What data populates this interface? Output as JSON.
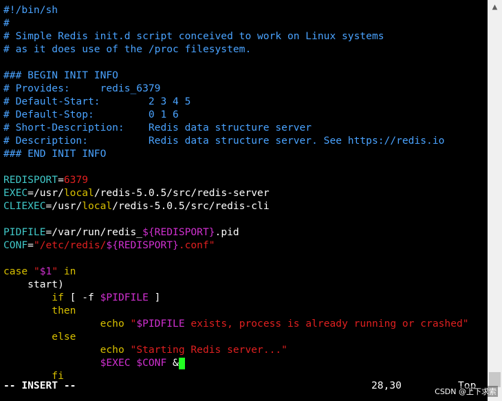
{
  "editor": {
    "lines": [
      [
        {
          "t": "#!/bin/sh",
          "c": "comment"
        }
      ],
      [
        {
          "t": "#",
          "c": "comment"
        }
      ],
      [
        {
          "t": "# Simple Redis init.d script conceived to work on Linux systems",
          "c": "comment"
        }
      ],
      [
        {
          "t": "# as it does use of the /proc filesystem.",
          "c": "comment"
        }
      ],
      [],
      [
        {
          "t": "### BEGIN INIT INFO",
          "c": "comment"
        }
      ],
      [
        {
          "t": "# Provides:     redis_6379",
          "c": "comment"
        }
      ],
      [
        {
          "t": "# Default-Start:        2 3 4 5",
          "c": "comment"
        }
      ],
      [
        {
          "t": "# Default-Stop:         0 1 6",
          "c": "comment"
        }
      ],
      [
        {
          "t": "# Short-Description:    Redis data structure server",
          "c": "comment"
        }
      ],
      [
        {
          "t": "# Description:          Redis data structure server. See https://redis.io",
          "c": "comment"
        }
      ],
      [
        {
          "t": "### END INIT INFO",
          "c": "comment"
        }
      ],
      [],
      [
        {
          "t": "REDISPORT",
          "c": "id"
        },
        {
          "t": "=",
          "c": "plain"
        },
        {
          "t": "6379",
          "c": "num"
        }
      ],
      [
        {
          "t": "EXEC",
          "c": "id"
        },
        {
          "t": "=/usr/",
          "c": "plain"
        },
        {
          "t": "local",
          "c": "kw"
        },
        {
          "t": "/redis-5.0.5/src/redis-server",
          "c": "plain"
        }
      ],
      [
        {
          "t": "CLIEXEC",
          "c": "id"
        },
        {
          "t": "=/usr/",
          "c": "plain"
        },
        {
          "t": "local",
          "c": "kw"
        },
        {
          "t": "/redis-5.0.5/src/redis-cli",
          "c": "plain"
        }
      ],
      [],
      [
        {
          "t": "PIDFILE",
          "c": "id"
        },
        {
          "t": "=/var/run/redis_",
          "c": "plain"
        },
        {
          "t": "${REDISPORT}",
          "c": "var"
        },
        {
          "t": ".pid",
          "c": "plain"
        }
      ],
      [
        {
          "t": "CONF",
          "c": "id"
        },
        {
          "t": "=",
          "c": "plain"
        },
        {
          "t": "\"/etc/redis/",
          "c": "str"
        },
        {
          "t": "${REDISPORT}",
          "c": "var"
        },
        {
          "t": ".conf\"",
          "c": "str"
        }
      ],
      [],
      [
        {
          "t": "case ",
          "c": "kw"
        },
        {
          "t": "\"",
          "c": "str"
        },
        {
          "t": "$1",
          "c": "var"
        },
        {
          "t": "\"",
          "c": "str"
        },
        {
          "t": " in",
          "c": "kw"
        }
      ],
      [
        {
          "t": "    start)",
          "c": "plain"
        }
      ],
      [
        {
          "t": "        ",
          "c": "plain"
        },
        {
          "t": "if",
          "c": "kw"
        },
        {
          "t": " [ -f ",
          "c": "plain"
        },
        {
          "t": "$PIDFILE",
          "c": "var"
        },
        {
          "t": " ]",
          "c": "plain"
        }
      ],
      [
        {
          "t": "        ",
          "c": "plain"
        },
        {
          "t": "then",
          "c": "kw"
        }
      ],
      [
        {
          "t": "                ",
          "c": "plain"
        },
        {
          "t": "echo ",
          "c": "kw"
        },
        {
          "t": "\"",
          "c": "str"
        },
        {
          "t": "$PIDFILE",
          "c": "var"
        },
        {
          "t": " exists, process is already running or crashed\"",
          "c": "str"
        }
      ],
      [
        {
          "t": "        ",
          "c": "plain"
        },
        {
          "t": "else",
          "c": "kw"
        }
      ],
      [
        {
          "t": "                ",
          "c": "plain"
        },
        {
          "t": "echo ",
          "c": "kw"
        },
        {
          "t": "\"Starting Redis server...\"",
          "c": "str"
        }
      ],
      [
        {
          "t": "                ",
          "c": "plain"
        },
        {
          "t": "$EXEC $CONF",
          "c": "var"
        },
        {
          "t": " &",
          "c": "plain"
        },
        {
          "t": "CURSOR",
          "c": "cursor"
        }
      ],
      [
        {
          "t": "        ",
          "c": "plain"
        },
        {
          "t": "fi",
          "c": "kw"
        }
      ]
    ]
  },
  "status": {
    "mode": "-- INSERT --",
    "position": "28,30",
    "scroll": "Top"
  },
  "watermark": "CSDN @上下求索",
  "colors": {
    "comment": "#4aa3ff",
    "identifier": "#40c8c8",
    "string": "#e02020",
    "variable": "#d030d0",
    "keyword": "#d8c000",
    "cursor": "#22ff22"
  }
}
